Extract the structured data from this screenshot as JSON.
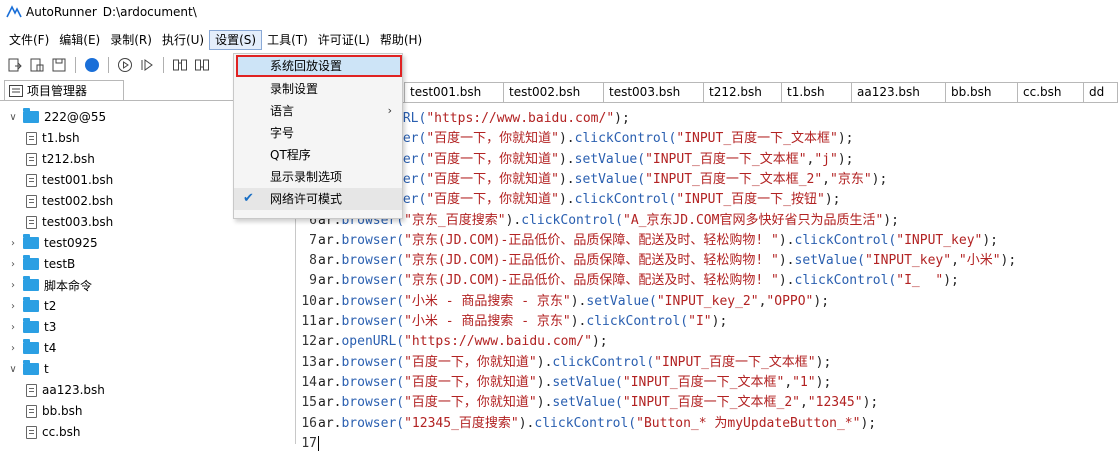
{
  "window": {
    "app_name": "AutoRunner",
    "path": "D:\\ardocument\\"
  },
  "menubar": [
    {
      "label": "文件(F)"
    },
    {
      "label": "编辑(E)"
    },
    {
      "label": "录制(R)"
    },
    {
      "label": "执行(U)"
    },
    {
      "label": "设置(S)"
    },
    {
      "label": "工具(T)"
    },
    {
      "label": "许可证(L)"
    },
    {
      "label": "帮助(H)"
    }
  ],
  "toolbar": {
    "icons": [
      "open-file-icon",
      "save-as-icon",
      "save-icon",
      "record-icon",
      "play-icon",
      "step-icon",
      "find-icon",
      "replace-icon"
    ],
    "record_color": "#1a6fd8"
  },
  "sidebar": {
    "title": "项目管理器",
    "folder_color": "#2b9fe3",
    "tree": [
      {
        "label": "222@@55",
        "type": "folder",
        "expanded": true
      },
      {
        "label": "t1.bsh",
        "type": "file"
      },
      {
        "label": "t212.bsh",
        "type": "file"
      },
      {
        "label": "test001.bsh",
        "type": "file"
      },
      {
        "label": "test002.bsh",
        "type": "file"
      },
      {
        "label": "test003.bsh",
        "type": "file"
      },
      {
        "label": "test0925",
        "type": "folder",
        "expanded": false
      },
      {
        "label": "testB",
        "type": "folder",
        "expanded": false
      },
      {
        "label": "脚本命令",
        "type": "folder",
        "expanded": false
      },
      {
        "label": "t2",
        "type": "folder",
        "expanded": false
      },
      {
        "label": "t3",
        "type": "folder",
        "expanded": false
      },
      {
        "label": "t4",
        "type": "folder",
        "expanded": false
      },
      {
        "label": "t",
        "type": "folder",
        "expanded": true
      },
      {
        "label": "aa123.bsh",
        "type": "file"
      },
      {
        "label": "bb.bsh",
        "type": "file"
      },
      {
        "label": "cc.bsh",
        "type": "file"
      }
    ]
  },
  "tabs": [
    {
      "label": "test001.bsh"
    },
    {
      "label": "test002.bsh"
    },
    {
      "label": "test003.bsh"
    },
    {
      "label": "t212.bsh"
    },
    {
      "label": "t1.bsh"
    },
    {
      "label": "aa123.bsh"
    },
    {
      "label": "bb.bsh"
    },
    {
      "label": "cc.bsh"
    },
    {
      "label": "dd"
    }
  ],
  "editor": {
    "lines": [
      {
        "n": "",
        "segs": [
          [
            "fn",
            "URL("
          ],
          [
            "str",
            "\"https://www.baidu.com/\""
          ],
          [
            "p",
            ");"
          ]
        ]
      },
      {
        "n": "",
        "segs": [
          [
            "fn",
            "ser("
          ],
          [
            "str",
            "\"百度一下，你就知道\""
          ],
          [
            "p",
            ")."
          ],
          [
            "fn",
            "clickControl("
          ],
          [
            "str",
            "\"INPUT_百度一下_文本框\""
          ],
          [
            "p",
            ");"
          ]
        ]
      },
      {
        "n": "",
        "segs": [
          [
            "fn",
            "ser("
          ],
          [
            "str",
            "\"百度一下，你就知道\""
          ],
          [
            "p",
            ")."
          ],
          [
            "fn",
            "setValue("
          ],
          [
            "str",
            "\"INPUT_百度一下_文本框\""
          ],
          [
            "p",
            ","
          ],
          [
            "str",
            "\"j\""
          ],
          [
            "p",
            ");"
          ]
        ]
      },
      {
        "n": "",
        "segs": [
          [
            "fn",
            "ser("
          ],
          [
            "str",
            "\"百度一下，你就知道\""
          ],
          [
            "p",
            ")."
          ],
          [
            "fn",
            "setValue("
          ],
          [
            "str",
            "\"INPUT_百度一下_文本框_2\""
          ],
          [
            "p",
            ","
          ],
          [
            "str",
            "\"京东\""
          ],
          [
            "p",
            ");"
          ]
        ]
      },
      {
        "n": "",
        "segs": [
          [
            "fn",
            "ser("
          ],
          [
            "str",
            "\"百度一下，你就知道\""
          ],
          [
            "p",
            ")."
          ],
          [
            "fn",
            "clickControl("
          ],
          [
            "str",
            "\"INPUT_百度一下_按钮\""
          ],
          [
            "p",
            ");"
          ]
        ]
      },
      {
        "n": "6",
        "segs": [
          [
            "obj",
            "ar"
          ],
          [
            "p",
            "."
          ],
          [
            "fn",
            "browser("
          ],
          [
            "str",
            "\"京东_百度搜索\""
          ],
          [
            "p",
            ")."
          ],
          [
            "fn",
            "clickControl("
          ],
          [
            "str",
            "\"A_京东JD.COM官网多快好省只为品质生活\""
          ],
          [
            "p",
            ");"
          ]
        ]
      },
      {
        "n": "7",
        "segs": [
          [
            "obj",
            "ar"
          ],
          [
            "p",
            "."
          ],
          [
            "fn",
            "browser("
          ],
          [
            "str",
            "\"京东(JD.COM)-正品低价、品质保障、配送及时、轻松购物! \""
          ],
          [
            "p",
            ")."
          ],
          [
            "fn",
            "clickControl("
          ],
          [
            "str",
            "\"INPUT_key\""
          ],
          [
            "p",
            ");"
          ]
        ]
      },
      {
        "n": "8",
        "segs": [
          [
            "obj",
            "ar"
          ],
          [
            "p",
            "."
          ],
          [
            "fn",
            "browser("
          ],
          [
            "str",
            "\"京东(JD.COM)-正品低价、品质保障、配送及时、轻松购物! \""
          ],
          [
            "p",
            ")."
          ],
          [
            "fn",
            "setValue("
          ],
          [
            "str",
            "\"INPUT_key\""
          ],
          [
            "p",
            ","
          ],
          [
            "str",
            "\"小米\""
          ],
          [
            "p",
            ");"
          ]
        ]
      },
      {
        "n": "9",
        "segs": [
          [
            "obj",
            "ar"
          ],
          [
            "p",
            "."
          ],
          [
            "fn",
            "browser("
          ],
          [
            "str",
            "\"京东(JD.COM)-正品低价、品质保障、配送及时、轻松购物! \""
          ],
          [
            "p",
            ")."
          ],
          [
            "fn",
            "clickControl("
          ],
          [
            "str",
            "\"I_  \""
          ],
          [
            "p",
            ");"
          ]
        ]
      },
      {
        "n": "10",
        "segs": [
          [
            "obj",
            "ar"
          ],
          [
            "p",
            "."
          ],
          [
            "fn",
            "browser("
          ],
          [
            "str",
            "\"小米 - 商品搜索 - 京东\""
          ],
          [
            "p",
            ")."
          ],
          [
            "fn",
            "setValue("
          ],
          [
            "str",
            "\"INPUT_key_2\""
          ],
          [
            "p",
            ","
          ],
          [
            "str",
            "\"OPPO\""
          ],
          [
            "p",
            ");"
          ]
        ]
      },
      {
        "n": "11",
        "segs": [
          [
            "obj",
            "ar"
          ],
          [
            "p",
            "."
          ],
          [
            "fn",
            "browser("
          ],
          [
            "str",
            "\"小米 - 商品搜索 - 京东\""
          ],
          [
            "p",
            ")."
          ],
          [
            "fn",
            "clickControl("
          ],
          [
            "str",
            "\"I\""
          ],
          [
            "p",
            ");"
          ]
        ]
      },
      {
        "n": "12",
        "segs": [
          [
            "obj",
            "ar"
          ],
          [
            "p",
            "."
          ],
          [
            "fn",
            "openURL("
          ],
          [
            "str",
            "\"https://www.baidu.com/\""
          ],
          [
            "p",
            ");"
          ]
        ]
      },
      {
        "n": "13",
        "segs": [
          [
            "obj",
            "ar"
          ],
          [
            "p",
            "."
          ],
          [
            "fn",
            "browser("
          ],
          [
            "str",
            "\"百度一下，你就知道\""
          ],
          [
            "p",
            ")."
          ],
          [
            "fn",
            "clickControl("
          ],
          [
            "str",
            "\"INPUT_百度一下_文本框\""
          ],
          [
            "p",
            ");"
          ]
        ]
      },
      {
        "n": "14",
        "segs": [
          [
            "obj",
            "ar"
          ],
          [
            "p",
            "."
          ],
          [
            "fn",
            "browser("
          ],
          [
            "str",
            "\"百度一下，你就知道\""
          ],
          [
            "p",
            ")."
          ],
          [
            "fn",
            "setValue("
          ],
          [
            "str",
            "\"INPUT_百度一下_文本框\""
          ],
          [
            "p",
            ","
          ],
          [
            "str",
            "\"1\""
          ],
          [
            "p",
            ");"
          ]
        ]
      },
      {
        "n": "15",
        "segs": [
          [
            "obj",
            "ar"
          ],
          [
            "p",
            "."
          ],
          [
            "fn",
            "browser("
          ],
          [
            "str",
            "\"百度一下，你就知道\""
          ],
          [
            "p",
            ")."
          ],
          [
            "fn",
            "setValue("
          ],
          [
            "str",
            "\"INPUT_百度一下_文本框_2\""
          ],
          [
            "p",
            ","
          ],
          [
            "str",
            "\"12345\""
          ],
          [
            "p",
            ");"
          ]
        ]
      },
      {
        "n": "16",
        "segs": [
          [
            "obj",
            "ar"
          ],
          [
            "p",
            "."
          ],
          [
            "fn",
            "browser("
          ],
          [
            "str",
            "\"12345_百度搜索\""
          ],
          [
            "p",
            ")."
          ],
          [
            "fn",
            "clickControl("
          ],
          [
            "str",
            "\"Button_* 为myUpdateButton_*\""
          ],
          [
            "p",
            ");"
          ]
        ]
      },
      {
        "n": "17",
        "segs": []
      }
    ]
  },
  "settings_menu": {
    "items": [
      {
        "label": "系统回放设置",
        "highlighted": true
      },
      {
        "label": "录制设置"
      },
      {
        "label": "语言",
        "submenu": true
      },
      {
        "label": "字号"
      },
      {
        "label": "QT程序"
      },
      {
        "label": "显示录制选项"
      },
      {
        "label": "网络许可模式",
        "checked": true
      }
    ]
  }
}
